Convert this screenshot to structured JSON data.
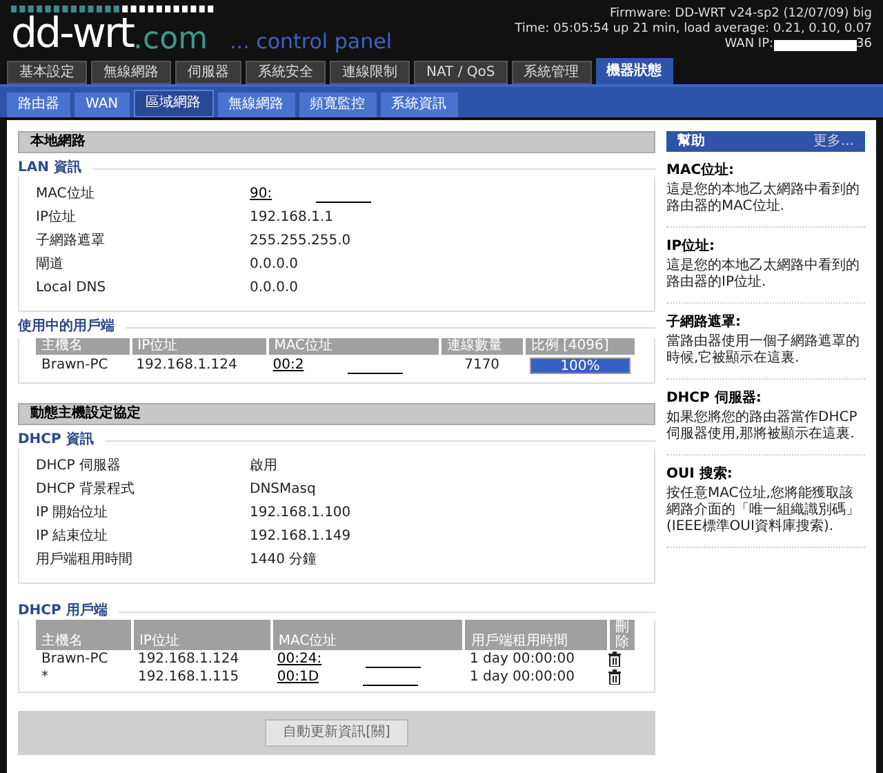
{
  "header": {
    "firmware": "Firmware: DD-WRT v24-sp2 (12/07/09) big",
    "time": "Time: 05:05:54 up 21 min, load average: 0.21, 0.10, 0.07",
    "wan_ip_label": "WAN IP:",
    "wan_ip_suffix": "36"
  },
  "logo": {
    "name": "dd-wrt",
    "domain": ".com",
    "subtitle": "... control panel"
  },
  "main_tabs": [
    {
      "label": "基本設定",
      "selected": false
    },
    {
      "label": "無線網路",
      "selected": false
    },
    {
      "label": "伺服器",
      "selected": false
    },
    {
      "label": "系統安全",
      "selected": false
    },
    {
      "label": "連線限制",
      "selected": false
    },
    {
      "label": "NAT / QoS",
      "selected": false
    },
    {
      "label": "系統管理",
      "selected": false
    },
    {
      "label": "機器狀態",
      "selected": true
    }
  ],
  "sub_tabs": [
    {
      "label": "路由器",
      "selected": false
    },
    {
      "label": "WAN",
      "selected": false
    },
    {
      "label": "區域網路",
      "selected": true
    },
    {
      "label": "無線網路",
      "selected": false
    },
    {
      "label": "頻寬監控",
      "selected": false
    },
    {
      "label": "系統資訊",
      "selected": false
    }
  ],
  "local_network": {
    "title": "本地網路",
    "lan_info": {
      "legend": "LAN 資訊",
      "rows": [
        {
          "label": "MAC位址",
          "value": "90:",
          "kind": "link"
        },
        {
          "label": "IP位址",
          "value": "192.168.1.1",
          "kind": "text"
        },
        {
          "label": "子網路遮罩",
          "value": "255.255.255.0",
          "kind": "text"
        },
        {
          "label": "閘道",
          "value": "0.0.0.0",
          "kind": "text"
        },
        {
          "label": "Local DNS",
          "value": "0.0.0.0",
          "kind": "text"
        }
      ]
    },
    "active_clients": {
      "legend": "使用中的用戶端",
      "columns": [
        "主機名",
        "IP位址",
        "MAC位址",
        "連線數量",
        "比例 [4096]"
      ],
      "rows": [
        {
          "hostname": "Brawn-PC",
          "ip": "192.168.1.124",
          "mac": "00:2",
          "connections": "7170",
          "ratio": "100%",
          "level": 1
        }
      ]
    }
  },
  "dhcp": {
    "title": "動態主機設定協定",
    "dhcp_info": {
      "legend": "DHCP 資訊",
      "rows": [
        {
          "label": "DHCP 伺服器",
          "value": "啟用"
        },
        {
          "label": "DHCP 背景程式",
          "value": "DNSMasq"
        },
        {
          "label": "IP 開始位址",
          "value": "192.168.1.100"
        },
        {
          "label": "IP 結束位址",
          "value": "192.168.1.149"
        },
        {
          "label": "用戶端租用時間",
          "value": "1440 分鐘"
        }
      ]
    },
    "dhcp_clients": {
      "legend": "DHCP 用戶端",
      "columns": [
        "主機名",
        "IP位址",
        "MAC位址",
        "用戶端租用時間",
        "刪除"
      ],
      "rows": [
        {
          "hostname": "Brawn-PC",
          "ip": "192.168.1.124",
          "mac": "00:24:",
          "lease": "1 day 00:00:00"
        },
        {
          "hostname": "*",
          "ip": "192.168.1.115",
          "mac": "00:1D",
          "lease": "1 day 00:00:00"
        }
      ]
    }
  },
  "refresh_button": {
    "label": "自動更新資訊[關]",
    "disabled": true
  },
  "help": {
    "title": "幫助",
    "more": "更多...",
    "items": [
      {
        "title": "MAC位址:",
        "text": "這是您的本地乙太網路中看到的路由器的MAC位址."
      },
      {
        "title": "IP位址:",
        "text": "這是您的本地乙太網路中看到的路由器的IP位址."
      },
      {
        "title": "子網路遮罩:",
        "text": "當路由器使用一個子網路遮罩的時候,它被顯示在這裏."
      },
      {
        "title": "DHCP 伺服器:",
        "text": "如果您將您的路由器當作DHCP伺服器使用,那將被顯示在這裏."
      },
      {
        "title": "OUI 搜索:",
        "text": "按任意MAC位址,您將能獲取該網路介面的「唯一組織識別碼」(IEEE標準OUI資料庫搜索)."
      }
    ]
  }
}
